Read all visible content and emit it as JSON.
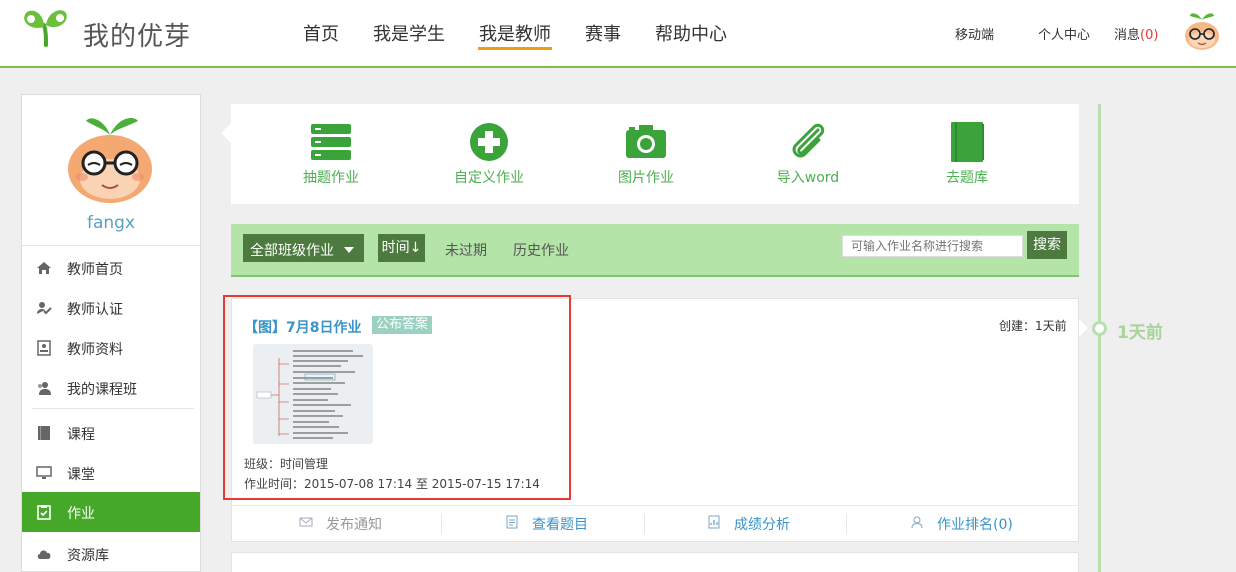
{
  "header": {
    "logo_text": "我的优芽",
    "nav": [
      {
        "label": "首页"
      },
      {
        "label": "我是学生"
      },
      {
        "label": "我是教师"
      },
      {
        "label": "赛事"
      },
      {
        "label": "帮助中心"
      }
    ],
    "mobile_label": "移动端",
    "personal_center_label": "个人中心",
    "messages_label": "消息",
    "messages_count": "(0)"
  },
  "sidebar": {
    "username": "fangx",
    "items": [
      {
        "label": "教师首页",
        "icon": "home-icon"
      },
      {
        "label": "教师认证",
        "icon": "verified-user-icon"
      },
      {
        "label": "教师资料",
        "icon": "profile-card-icon"
      },
      {
        "label": "我的课程班",
        "icon": "class-users-icon"
      },
      {
        "label": "课程",
        "icon": "book-icon"
      },
      {
        "label": "课堂",
        "icon": "monitor-icon"
      },
      {
        "label": "作业",
        "icon": "clipboard-icon"
      },
      {
        "label": "资源库",
        "icon": "cloud-icon"
      }
    ],
    "active_item": "作业"
  },
  "tools": [
    {
      "label": "抽题作业",
      "icon": "stack-icon"
    },
    {
      "label": "自定义作业",
      "icon": "plus-circle-icon"
    },
    {
      "label": "图片作业",
      "icon": "camera-icon"
    },
    {
      "label": "导入word",
      "icon": "paperclip-icon"
    },
    {
      "label": "去题库",
      "icon": "book-icon"
    }
  ],
  "filter": {
    "dropdown_label": "全部班级作业",
    "time_sort_label": "时间↓",
    "tab_not_expired": "未过期",
    "tab_history": "历史作业",
    "search_placeholder": "可输入作业名称进行搜索",
    "search_button": "搜索"
  },
  "assignment": {
    "title": "【图】7月8日作业",
    "badge": "公布答案",
    "created": "创建：1天前",
    "class_line": "班级：时间管理",
    "time_line": "作业时间：2015-07-08 17:14 至 2015-07-15 17:14",
    "actions": {
      "notify": "发布通知",
      "view_questions": "查看题目",
      "analysis": "成绩分析",
      "ranking": "作业排名(0)"
    }
  },
  "timeline": {
    "label": "1天前"
  },
  "colors": {
    "brand_green": "#46a828",
    "filter_bar": "#b5e4a9",
    "dark_green_button": "#4d7a3f",
    "link_blue": "#3a94c8",
    "highlight_red": "#e53935",
    "nav_active_underline": "#f39c12"
  }
}
